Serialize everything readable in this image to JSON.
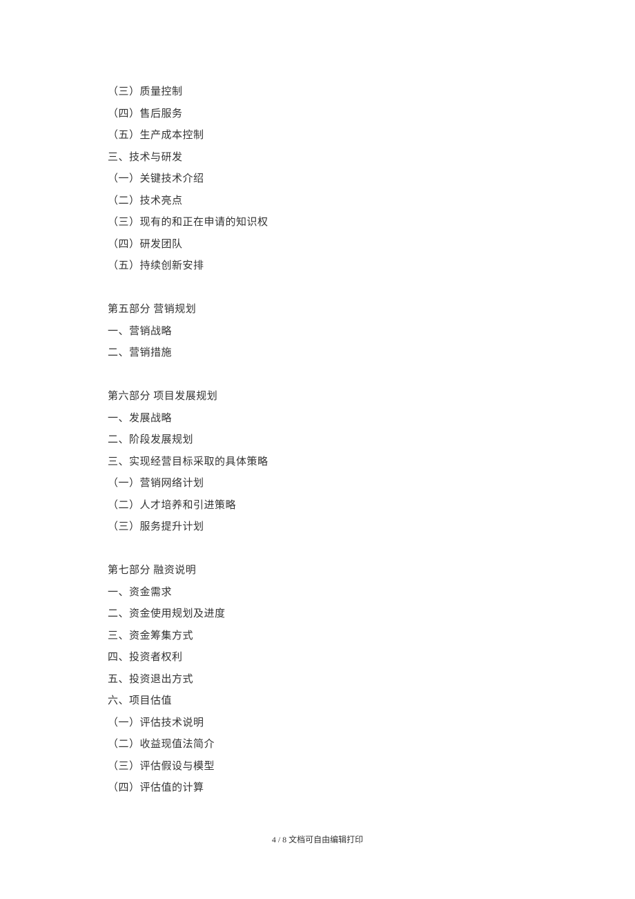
{
  "lines": [
    "（三）质量控制",
    "（四）售后服务",
    "（五）生产成本控制",
    "三、技术与研发",
    "（一）关键技术介绍",
    "（二）技术亮点",
    "（三）现有的和正在申请的知识权",
    "（四）研发团队",
    "（五）持续创新安排",
    "",
    "第五部分  营销规划",
    "一、营销战略",
    "二、营销措施",
    "",
    "第六部分  项目发展规划",
    "一、发展战略",
    "二、阶段发展规划",
    "三、实现经营目标采取的具体策略",
    "（一）营销网络计划",
    "（二）人才培养和引进策略",
    "（三）服务提升计划",
    "",
    "第七部分  融资说明",
    "一、资金需求",
    "二、资金使用规划及进度",
    "三、资金筹集方式",
    "四、投资者权利",
    "五、投资退出方式",
    "六、项目估值",
    "（一）评估技术说明",
    "（二）收益现值法简介",
    "（三）评估假设与模型",
    "（四）评估值的计算"
  ],
  "footer": "4 / 8 文档可自由编辑打印"
}
